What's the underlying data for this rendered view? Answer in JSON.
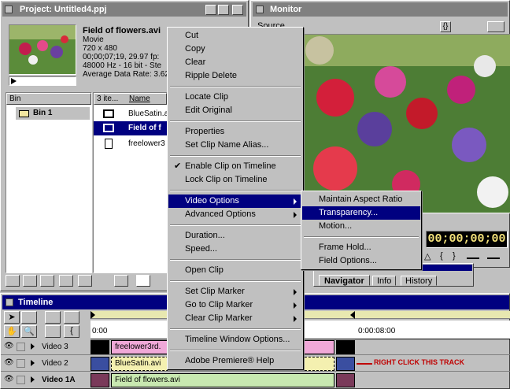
{
  "project": {
    "title": "Project: Untitled4.ppj",
    "clip_name": "Field of flowers.avi",
    "clip_type": "Movie",
    "clip_size": "720 x 480",
    "clip_duration": "00;00;07;19, 29.97 fp:",
    "clip_audio": "48000 Hz - 16 bit - Ste",
    "clip_rate": "Average Data Rate: 3.62",
    "bin_header": "Bin",
    "bin_name": "Bin 1",
    "items_header": "3 ite...",
    "name_header": "Name",
    "items": [
      {
        "name": "BlueSatin.a",
        "icon": "film-strip-icon"
      },
      {
        "name": "Field of f",
        "icon": "movie-clip-icon"
      },
      {
        "name": "freelower3",
        "icon": "document-icon"
      }
    ]
  },
  "monitor": {
    "title": "Monitor",
    "source_label": "Source",
    "timecode": "00;00;00;00"
  },
  "navigator": {
    "tabs": [
      "Navigator",
      "Info",
      "History"
    ]
  },
  "timeline": {
    "title": "Timeline",
    "time_start": "0:00",
    "time_mark": "0:00:08:00",
    "tracks": [
      {
        "name": "Video 3",
        "clip": "freelower3rd."
      },
      {
        "name": "Video 2",
        "clip": "BlueSatin.avi"
      },
      {
        "name": "Video 1A",
        "clip": "Field of flowers.avi"
      }
    ],
    "annotation": "RIGHT CLICK THIS TRACK"
  },
  "context_menu": {
    "items": [
      {
        "label": "Cut"
      },
      {
        "label": "Copy"
      },
      {
        "label": "Clear"
      },
      {
        "label": "Ripple Delete"
      },
      {
        "sep": true
      },
      {
        "label": "Locate Clip"
      },
      {
        "label": "Edit Original"
      },
      {
        "sep": true
      },
      {
        "label": "Properties"
      },
      {
        "label": "Set Clip Name Alias..."
      },
      {
        "sep": true
      },
      {
        "label": "Enable Clip on Timeline",
        "checked": true
      },
      {
        "label": "Lock Clip on Timeline"
      },
      {
        "sep": true
      },
      {
        "label": "Video Options",
        "submenu": true,
        "highlighted": true
      },
      {
        "label": "Advanced Options",
        "submenu": true
      },
      {
        "sep": true
      },
      {
        "label": "Duration..."
      },
      {
        "label": "Speed..."
      },
      {
        "sep": true
      },
      {
        "label": "Open Clip"
      },
      {
        "sep": true
      },
      {
        "label": "Set Clip Marker",
        "submenu": true
      },
      {
        "label": "Go to Clip Marker",
        "submenu": true
      },
      {
        "label": "Clear Clip Marker",
        "submenu": true
      },
      {
        "sep": true
      },
      {
        "label": "Timeline Window Options..."
      },
      {
        "sep": true
      },
      {
        "label": "Adobe Premiere® Help"
      }
    ]
  },
  "submenu": {
    "items": [
      {
        "label": "Maintain Aspect Ratio"
      },
      {
        "label": "Transparency...",
        "highlighted": true
      },
      {
        "label": "Motion..."
      },
      {
        "sep": true
      },
      {
        "label": "Frame Hold..."
      },
      {
        "label": "Field Options..."
      }
    ]
  }
}
